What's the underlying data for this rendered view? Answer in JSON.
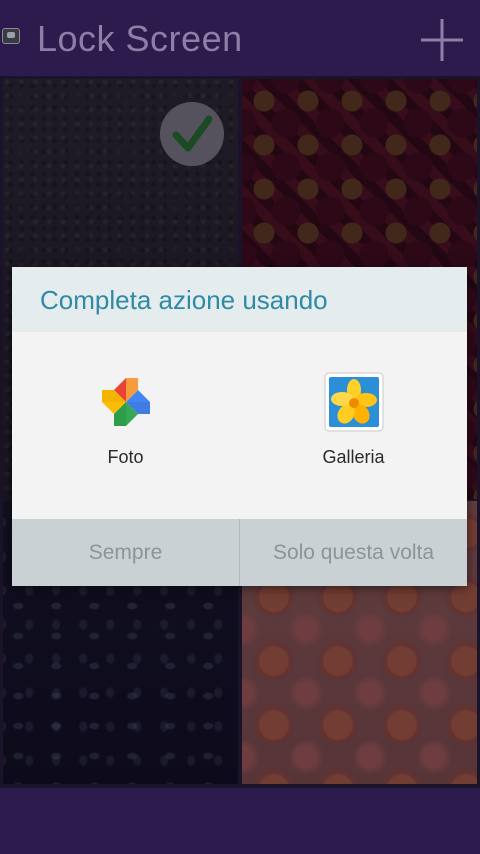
{
  "appbar": {
    "title": "Lock Screen",
    "icon": "app-icon",
    "action_icon": "plus-icon"
  },
  "wallpapers": [
    {
      "name": "dark-texture",
      "selected": true
    },
    {
      "name": "red-damask",
      "selected": false
    },
    {
      "name": "water-drops",
      "selected": false
    },
    {
      "name": "roses",
      "selected": false
    }
  ],
  "dialog": {
    "title": "Completa azione usando",
    "choices": [
      {
        "label": "Foto",
        "icon": "google-photos-icon"
      },
      {
        "label": "Galleria",
        "icon": "gallery-icon"
      }
    ],
    "actions": {
      "always": "Sempre",
      "once": "Solo questa volta"
    }
  },
  "colors": {
    "appbar": "#2e1b4e",
    "dialog_title": "#2f8aa6",
    "actions_bg": "#c9d1d4"
  }
}
